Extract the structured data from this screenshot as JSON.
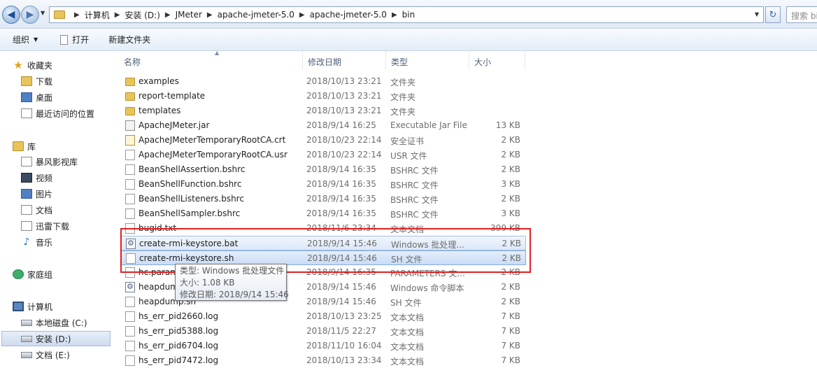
{
  "address": {
    "crumbs": [
      "计算机",
      "安装 (D:)",
      "JMeter",
      "apache-jmeter-5.0",
      "apache-jmeter-5.0",
      "bin"
    ],
    "search_placeholder": "搜索 bin"
  },
  "toolbar": {
    "organize": "组织",
    "open": "打开",
    "new_folder": "新建文件夹"
  },
  "nav": {
    "favorites": "收藏夹",
    "downloads": "下载",
    "desktop": "桌面",
    "recent": "最近访问的位置",
    "libraries": "库",
    "baofeng": "暴风影视库",
    "videos": "视频",
    "pictures": "图片",
    "documents": "文档",
    "xunlei": "迅雷下载",
    "music": "音乐",
    "homegroup": "家庭组",
    "computer": "计算机",
    "drive_c": "本地磁盘 (C:)",
    "drive_d": "安装 (D:)",
    "drive_e": "文档 (E:)"
  },
  "columns": {
    "name": "名称",
    "date": "修改日期",
    "type": "类型",
    "size": "大小"
  },
  "files": [
    {
      "name": "examples",
      "date": "2018/10/13 23:21",
      "type": "文件夹",
      "size": "",
      "icon": "folder-icon"
    },
    {
      "name": "report-template",
      "date": "2018/10/13 23:21",
      "type": "文件夹",
      "size": "",
      "icon": "folder-icon"
    },
    {
      "name": "templates",
      "date": "2018/10/13 23:21",
      "type": "文件夹",
      "size": "",
      "icon": "folder-icon"
    },
    {
      "name": "ApacheJMeter.jar",
      "date": "2018/9/14 16:25",
      "type": "Executable Jar File",
      "size": "13 KB",
      "icon": "jar-file-icon"
    },
    {
      "name": "ApacheJMeterTemporaryRootCA.crt",
      "date": "2018/10/23 22:14",
      "type": "安全证书",
      "size": "2 KB",
      "icon": "certificate-icon"
    },
    {
      "name": "ApacheJMeterTemporaryRootCA.usr",
      "date": "2018/10/23 22:14",
      "type": "USR 文件",
      "size": "2 KB",
      "icon": "file-icon"
    },
    {
      "name": "BeanShellAssertion.bshrc",
      "date": "2018/9/14 16:35",
      "type": "BSHRC 文件",
      "size": "2 KB",
      "icon": "file-icon"
    },
    {
      "name": "BeanShellFunction.bshrc",
      "date": "2018/9/14 16:35",
      "type": "BSHRC 文件",
      "size": "3 KB",
      "icon": "file-icon"
    },
    {
      "name": "BeanShellListeners.bshrc",
      "date": "2018/9/14 16:35",
      "type": "BSHRC 文件",
      "size": "2 KB",
      "icon": "file-icon"
    },
    {
      "name": "BeanShellSampler.bshrc",
      "date": "2018/9/14 16:35",
      "type": "BSHRC 文件",
      "size": "3 KB",
      "icon": "file-icon"
    },
    {
      "name": "bugid.txt",
      "date": "2018/11/6 23:34",
      "type": "文本文档",
      "size": "399 KB",
      "icon": "text-file-icon"
    },
    {
      "name": "create-rmi-keystore.bat",
      "date": "2018/9/14 15:46",
      "type": "Windows 批处理...",
      "size": "2 KB",
      "icon": "batch-file-icon"
    },
    {
      "name": "create-rmi-keystore.sh",
      "date": "2018/9/14 15:46",
      "type": "SH 文件",
      "size": "2 KB",
      "icon": "file-icon"
    },
    {
      "name": "hc.parameters",
      "date": "2018/9/14 16:35",
      "type": "PARAMETERS 文...",
      "size": "2 KB",
      "icon": "file-icon"
    },
    {
      "name": "heapdump.cmd",
      "date": "2018/9/14 15:46",
      "type": "Windows 命令脚本",
      "size": "2 KB",
      "icon": "batch-file-icon"
    },
    {
      "name": "heapdump.sh",
      "date": "2018/9/14 15:46",
      "type": "SH 文件",
      "size": "2 KB",
      "icon": "file-icon"
    },
    {
      "name": "hs_err_pid2660.log",
      "date": "2018/10/13 23:25",
      "type": "文本文档",
      "size": "7 KB",
      "icon": "text-file-icon"
    },
    {
      "name": "hs_err_pid5388.log",
      "date": "2018/11/5 22:27",
      "type": "文本文档",
      "size": "7 KB",
      "icon": "text-file-icon"
    },
    {
      "name": "hs_err_pid6704.log",
      "date": "2018/11/10 16:04",
      "type": "文本文档",
      "size": "7 KB",
      "icon": "text-file-icon"
    },
    {
      "name": "hs_err_pid7472.log",
      "date": "2018/10/13 23:34",
      "type": "文本文档",
      "size": "7 KB",
      "icon": "text-file-icon"
    }
  ],
  "tooltip": {
    "type_line": "类型: Windows 批处理文件",
    "size_line": "大小: 1.08 KB",
    "date_line": "修改日期: 2018/9/14 15:46"
  },
  "colors": {
    "annotation": "#e02020",
    "selection": "#cadcf5"
  }
}
